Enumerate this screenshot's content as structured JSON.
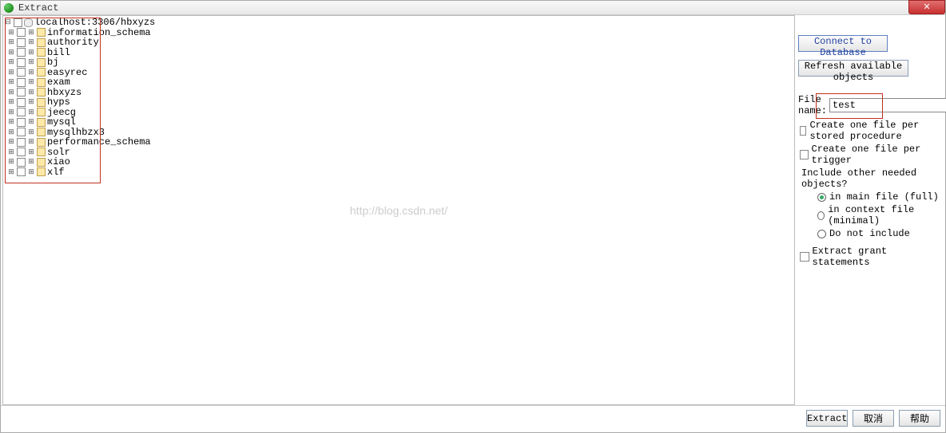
{
  "window": {
    "title": "Extract",
    "watermark": "http://blog.csdn.net/"
  },
  "tree": {
    "root": {
      "label": "localhost:3306/hbxyzs"
    },
    "children": [
      "information_schema",
      "authority",
      "bill",
      "bj",
      "easyrec",
      "exam",
      "hbxyzs",
      "hyps",
      "jeecg",
      "mysql",
      "mysqlhbzx3",
      "performance_schema",
      "solr",
      "xiao",
      "xlf"
    ]
  },
  "right": {
    "connect_btn": "Connect to Database",
    "refresh_btn": "Refresh available objects",
    "file_name_label": "File name:",
    "file_name_value": "test",
    "chk_sp": "Create one file per stored procedure",
    "chk_trigger": "Create one file per trigger",
    "include_label": "Include other needed objects?",
    "rad_main": "in main file (full)",
    "rad_context": "in context file (minimal)",
    "rad_none": "Do not include",
    "chk_grant": "Extract grant statements"
  },
  "footer": {
    "extract": "Extract",
    "cancel": "取消",
    "help": "帮助"
  }
}
